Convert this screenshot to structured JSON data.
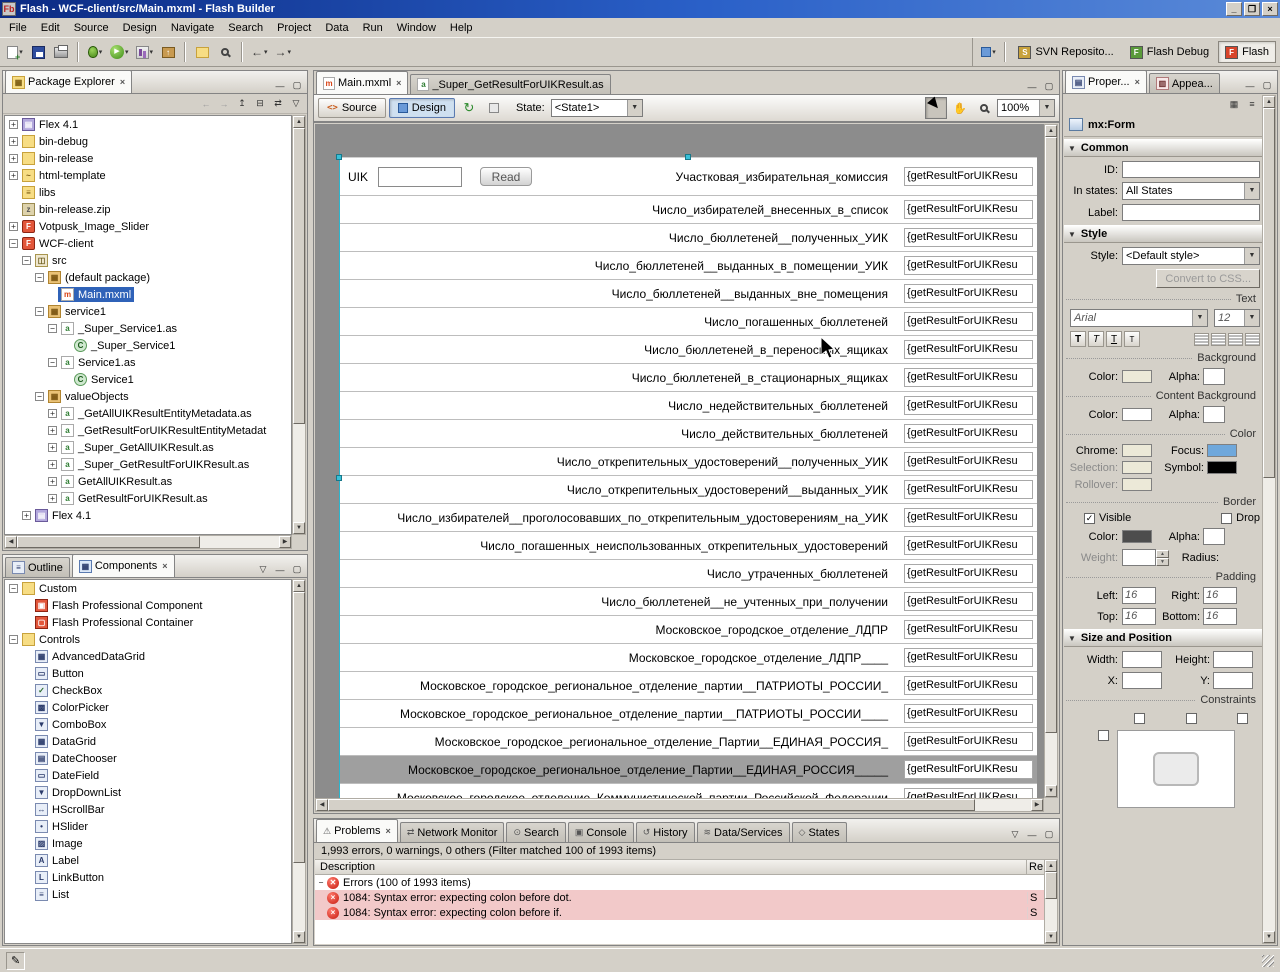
{
  "window": {
    "title": "Flash - WCF-client/src/Main.mxml - Flash Builder",
    "app_badge": "Fb",
    "minimize": "_",
    "maximize": "❐",
    "close": "×"
  },
  "menu": {
    "items": [
      "File",
      "Edit",
      "Source",
      "Design",
      "Navigate",
      "Search",
      "Project",
      "Data",
      "Run",
      "Window",
      "Help"
    ]
  },
  "toolbar": {
    "perspectives": [
      {
        "label": "SVN Reposito...",
        "active": false
      },
      {
        "label": "Flash Debug",
        "active": false
      },
      {
        "label": "Flash",
        "active": true
      }
    ]
  },
  "package_explorer": {
    "title": "Package Explorer",
    "items": [
      {
        "depth": 0,
        "expand": "+",
        "icon": "flex-library",
        "label": "Flex 4.1"
      },
      {
        "depth": 0,
        "expand": "+",
        "icon": "folder",
        "label": "bin-debug"
      },
      {
        "depth": 0,
        "expand": "+",
        "icon": "folder",
        "label": "bin-release"
      },
      {
        "depth": 0,
        "expand": "+",
        "icon": "web-folder",
        "label": "html-template"
      },
      {
        "depth": 0,
        "expand": "",
        "icon": "lib-folder",
        "label": "libs"
      },
      {
        "depth": 0,
        "expand": "",
        "icon": "zip",
        "label": "bin-release.zip"
      },
      {
        "depth": 0,
        "expand": "+",
        "icon": "flash-project",
        "label": "Votpusk_Image_Slider"
      },
      {
        "depth": 0,
        "expand": "-",
        "icon": "flash-project",
        "label": "WCF-client"
      },
      {
        "depth": 1,
        "expand": "-",
        "icon": "source-folder",
        "label": "src"
      },
      {
        "depth": 2,
        "expand": "-",
        "icon": "package",
        "label": "(default package)"
      },
      {
        "depth": 3,
        "expand": "",
        "icon": "mxml-file",
        "label": "Main.mxml",
        "selected": true
      },
      {
        "depth": 2,
        "expand": "-",
        "icon": "package",
        "label": "service1"
      },
      {
        "depth": 3,
        "expand": "-",
        "icon": "as-file",
        "label": "_Super_Service1.as"
      },
      {
        "depth": 4,
        "expand": "",
        "icon": "as-class",
        "label": "_Super_Service1"
      },
      {
        "depth": 3,
        "expand": "-",
        "icon": "as-file",
        "label": "Service1.as"
      },
      {
        "depth": 4,
        "expand": "",
        "icon": "as-class",
        "label": "Service1"
      },
      {
        "depth": 2,
        "expand": "-",
        "icon": "package",
        "label": "valueObjects"
      },
      {
        "depth": 3,
        "expand": "+",
        "icon": "as-file",
        "label": "_GetAllUIKResultEntityMetadata.as"
      },
      {
        "depth": 3,
        "expand": "+",
        "icon": "as-file",
        "label": "_GetResultForUIKResultEntityMetadat"
      },
      {
        "depth": 3,
        "expand": "+",
        "icon": "as-file",
        "label": "_Super_GetAllUIKResult.as"
      },
      {
        "depth": 3,
        "expand": "+",
        "icon": "as-file",
        "label": "_Super_GetResultForUIKResult.as"
      },
      {
        "depth": 3,
        "expand": "+",
        "icon": "as-file",
        "label": "GetAllUIKResult.as"
      },
      {
        "depth": 3,
        "expand": "+",
        "icon": "as-file",
        "label": "GetResultForUIKResult.as"
      },
      {
        "depth": 1,
        "expand": "+",
        "icon": "flex-library",
        "label": "Flex 4.1"
      }
    ]
  },
  "left_bottom": {
    "tabs": [
      {
        "label": "Outline",
        "active": false
      },
      {
        "label": "Components",
        "active": true
      }
    ],
    "items": [
      {
        "depth": 0,
        "expand": "-",
        "icon": "folder",
        "label": "Custom"
      },
      {
        "depth": 1,
        "expand": "",
        "icon": "flash-component",
        "label": "Flash Professional Component"
      },
      {
        "depth": 1,
        "expand": "",
        "icon": "flash-container",
        "label": "Flash Professional Container"
      },
      {
        "depth": 0,
        "expand": "-",
        "icon": "folder",
        "label": "Controls"
      },
      {
        "depth": 1,
        "expand": "",
        "icon": "advanceddatagrid",
        "label": "AdvancedDataGrid"
      },
      {
        "depth": 1,
        "expand": "",
        "icon": "button",
        "label": "Button"
      },
      {
        "depth": 1,
        "expand": "",
        "icon": "checkbox",
        "label": "CheckBox"
      },
      {
        "depth": 1,
        "expand": "",
        "icon": "colorpicker",
        "label": "ColorPicker"
      },
      {
        "depth": 1,
        "expand": "",
        "icon": "combobox",
        "label": "ComboBox"
      },
      {
        "depth": 1,
        "expand": "",
        "icon": "datagrid",
        "label": "DataGrid"
      },
      {
        "depth": 1,
        "expand": "",
        "icon": "datechooser",
        "label": "DateChooser"
      },
      {
        "depth": 1,
        "expand": "",
        "icon": "datefield",
        "label": "DateField"
      },
      {
        "depth": 1,
        "expand": "",
        "icon": "dropdownlist",
        "label": "DropDownList"
      },
      {
        "depth": 1,
        "expand": "",
        "icon": "hscrollbar",
        "label": "HScrollBar"
      },
      {
        "depth": 1,
        "expand": "",
        "icon": "hslider",
        "label": "HSlider"
      },
      {
        "depth": 1,
        "expand": "",
        "icon": "image",
        "label": "Image"
      },
      {
        "depth": 1,
        "expand": "",
        "icon": "label",
        "label": "Label"
      },
      {
        "depth": 1,
        "expand": "",
        "icon": "linkbutton",
        "label": "LinkButton"
      },
      {
        "depth": 1,
        "expand": "",
        "icon": "list",
        "label": "List"
      }
    ]
  },
  "editor": {
    "tabs": [
      {
        "label": "Main.mxml",
        "active": true
      },
      {
        "label": "_Super_GetResultForUIKResult.as",
        "active": false
      }
    ],
    "toolbar": {
      "source_label": "Source",
      "design_label": "Design",
      "state_label": "State:",
      "state_value": "<State1>",
      "zoom_value": "100%"
    },
    "form": {
      "uik_label": "UIK",
      "read_button": "Read",
      "binding_value": "{getResultForUIKResu",
      "rows": [
        {
          "label": "Участковая_избирательная_комиссия"
        },
        {
          "label": "Число_избирателей_внесенных_в_список"
        },
        {
          "label": "Число_бюллетеней__полученных_УИК"
        },
        {
          "label": "Число_бюллетеней__выданных_в_помещении_УИК"
        },
        {
          "label": "Число_бюллетеней__выданных_вне_помещения"
        },
        {
          "label": "Число_погашенных_бюллетеней"
        },
        {
          "label": "Число_бюллетеней_в_переносных_ящиках"
        },
        {
          "label": "Число_бюллетеней_в_стационарных_ящиках"
        },
        {
          "label": "Число_недействительных_бюллетеней"
        },
        {
          "label": "Число_действительных_бюллетеней"
        },
        {
          "label": "Число_открепительных_удостоверений__полученных_УИК"
        },
        {
          "label": "Число_открепительных_удостоверений__выданных_УИК"
        },
        {
          "label": "Число_избирателей__проголосовавших_по_открепительным_удостоверениям_на_УИК"
        },
        {
          "label": "Число_погашенных_неиспользованных_открепительных_удостоверений"
        },
        {
          "label": "Число_утраченных_бюллетеней"
        },
        {
          "label": "Число_бюллетеней__не_учтенных_при_получении"
        },
        {
          "label": "Московское_городское_отделение_ЛДПР"
        },
        {
          "label": "Московское_городское_отделение_ЛДПР____"
        },
        {
          "label": "Московское_городское_региональное_отделение_партии__ПАТРИОТЫ_РОССИИ_"
        },
        {
          "label": "Московское_городское_региональное_отделение_партии__ПАТРИОТЫ_РОССИИ____"
        },
        {
          "label": "Московское_городское_региональное_отделение_Партии__ЕДИНАЯ_РОССИЯ_"
        },
        {
          "label": "Московское_городское_региональное_отделение_Партии__ЕДИНАЯ_РОССИЯ_____",
          "selected": true
        },
        {
          "label": "Московское_городское_отделение_Коммунистической_партии_Российской_Федерации"
        }
      ]
    }
  },
  "problems": {
    "tabs": [
      {
        "label": "Problems",
        "active": true
      },
      {
        "label": "Network Monitor",
        "active": false
      },
      {
        "label": "Search",
        "active": false
      },
      {
        "label": "Console",
        "active": false
      },
      {
        "label": "History",
        "active": false
      },
      {
        "label": "Data/Services",
        "active": false
      },
      {
        "label": "States",
        "active": false
      }
    ],
    "summary": "1,993 errors, 0 warnings, 0 others (Filter matched 100 of 1993 items)",
    "columns": {
      "description": "Description",
      "resource": "Re"
    },
    "group_label": "Errors (100 of 1993 items)",
    "rows": [
      {
        "message": "1084: Syntax error: expecting colon before dot.",
        "resource": "S"
      },
      {
        "message": "1084: Syntax error: expecting colon before if.",
        "resource": "S"
      }
    ]
  },
  "properties": {
    "tabs": [
      {
        "label": "Proper...",
        "active": true
      },
      {
        "label": "Appea...",
        "active": false
      }
    ],
    "target": "mx:Form",
    "common": {
      "title": "Common",
      "id_label": "ID:",
      "in_states_label": "In states:",
      "in_states_value": "All States",
      "label_label": "Label:"
    },
    "style": {
      "title": "Style",
      "style_label": "Style:",
      "style_value": "<Default style>",
      "convert_button": "Convert to CSS...",
      "text_heading": "Text",
      "font_family": "Arial",
      "font_size": "12",
      "background_heading": "Background",
      "color_label": "Color:",
      "alpha_label": "Alpha:",
      "content_background_heading": "Content Background",
      "color_heading": "Color",
      "chrome_label": "Chrome:",
      "focus_label": "Focus:",
      "selection_label": "Selection:",
      "symbol_label": "Symbol:",
      "rollover_label": "Rollover:",
      "border_heading": "Border",
      "visible_label": "Visible",
      "drop_label": "Drop",
      "weight_label": "Weight:",
      "radius_label": "Radius:",
      "padding_heading": "Padding",
      "left_label": "Left:",
      "left_value": "16",
      "right_label": "Right:",
      "right_value": "16",
      "top_label": "Top:",
      "top_value": "16",
      "bottom_label": "Bottom:",
      "bottom_value": "16"
    },
    "size_position": {
      "title": "Size and Position",
      "width_label": "Width:",
      "height_label": "Height:",
      "x_label": "X:",
      "y_label": "Y:",
      "constraints_heading": "Constraints"
    }
  },
  "colors": {
    "selection_blue": "#2f62b8",
    "error_row": "#f2c9c9",
    "focus_swatch": "#6fa8dc",
    "symbol_swatch": "#000000",
    "border_swatch": "#4d4d4d"
  }
}
